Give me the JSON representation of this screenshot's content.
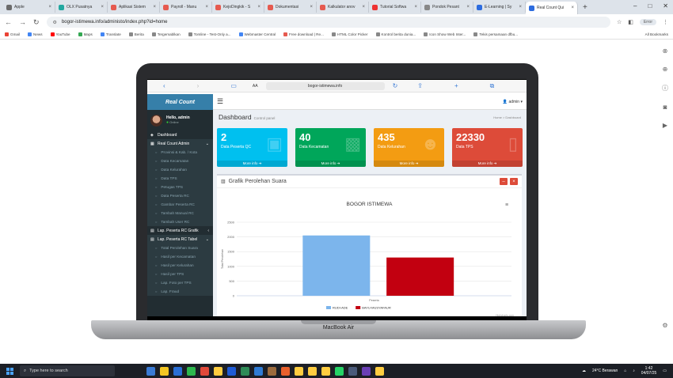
{
  "browser": {
    "tabs": [
      {
        "label": "Apple",
        "color": "#6b6b6b"
      },
      {
        "label": "OLX Pusatnya",
        "color": "#23a8a0"
      },
      {
        "label": "Aplikasi Sistem",
        "color": "#e65a4f"
      },
      {
        "label": "Payroll - Manu",
        "color": "#e65a4f"
      },
      {
        "label": "KejoDingkik - S",
        "color": "#e65a4f"
      },
      {
        "label": "Dokumentasi",
        "color": "#e65a4f"
      },
      {
        "label": "Kalkulator anov",
        "color": "#e65a4f"
      },
      {
        "label": "Tutorial Softwa",
        "color": "#e33"
      },
      {
        "label": "Pondok Pesant",
        "color": "#888"
      },
      {
        "label": "E-Learning | Sy",
        "color": "#2d6cdf"
      },
      {
        "label": "Real Count Qui",
        "color": "#2d6cdf"
      }
    ],
    "url": "bogor-istimewa.info/administo/index.php?id=home",
    "profile": "Error",
    "bookmarks": [
      "Gmail",
      "News",
      "YouTube",
      "Maps",
      "Translate",
      "Berita",
      "Tergemablkan",
      "Tomline - Test-Only a...",
      "Webmaster Central",
      "Free download | Re...",
      "HTML Color Picker",
      "Kontrol berita dunia...",
      "Icon Show Web Inter...",
      "Tekis persamaan dfbu..."
    ],
    "all_bookmarks": "All Bookmarks"
  },
  "ipad": {
    "aa": "AA",
    "url": "bogor-istimewa.info"
  },
  "app": {
    "brand": "Real Count",
    "user_name": "Hello, admin",
    "user_status": "Online",
    "admin_label": "admin",
    "menu": {
      "dashboard": "Dashboard",
      "real_count_admin": "Real Count Admin",
      "sub_admin": [
        "Provinsi & Kab. / Kota",
        "Data Kecamatan",
        "Data Kelurahan",
        "Data TPS",
        "Petugas TPS",
        "Data Peserta RC",
        "Gambar Peserta RC",
        "Tambah Manual RC",
        "Tambah User RC"
      ],
      "lap_grafik": "Lap. Peserta RC Grafik",
      "lap_tabel": "Lap. Peserta RC Tabel",
      "sub_tabel": [
        "Total Perolehan Suara",
        "Hasil per Kecamatan",
        "Hasil per Kelurahan",
        "Hasil per TPS",
        "Lap. Foto per TPS",
        "Lap. Fraud"
      ]
    },
    "page_title": "Dashboard",
    "page_subtitle": "Control panel",
    "breadcrumb": "Home > Dashboard",
    "boxes": [
      {
        "value": "2",
        "label": "Data Peserta QC",
        "more": "More info",
        "color": "#00c0ef"
      },
      {
        "value": "40",
        "label": "Data Kecamatan",
        "more": "More info",
        "color": "#00a65a"
      },
      {
        "value": "435",
        "label": "Data Kelurahan",
        "more": "More info",
        "color": "#f39c12"
      },
      {
        "value": "22330",
        "label": "Data TPS",
        "more": "More info",
        "color": "#dd4b39"
      }
    ],
    "chart_box_title": "Grafik Perolehan Suara"
  },
  "chart_data": {
    "type": "bar",
    "title": "BOGOR ISTIMEWA",
    "ylabel": "Total Perolehan",
    "xlabel": "Peserta",
    "ylim": [
      0,
      2500
    ],
    "yticks": [
      0,
      500,
      1000,
      1500,
      2000,
      2500
    ],
    "series": [
      {
        "name": "RUDI-ADE",
        "value": 2050,
        "color": "#7cb5ec"
      },
      {
        "name": "BAYU-MUSYAFAUR",
        "value": 1300,
        "color": "#c20010"
      }
    ],
    "credits": "Highcharts.com"
  },
  "laptop_label": "MacBook Air",
  "taskbar": {
    "search_placeholder": "Type here to search",
    "weather": "24°C  Berawan",
    "time": "1:42",
    "date": "04/07/25"
  }
}
